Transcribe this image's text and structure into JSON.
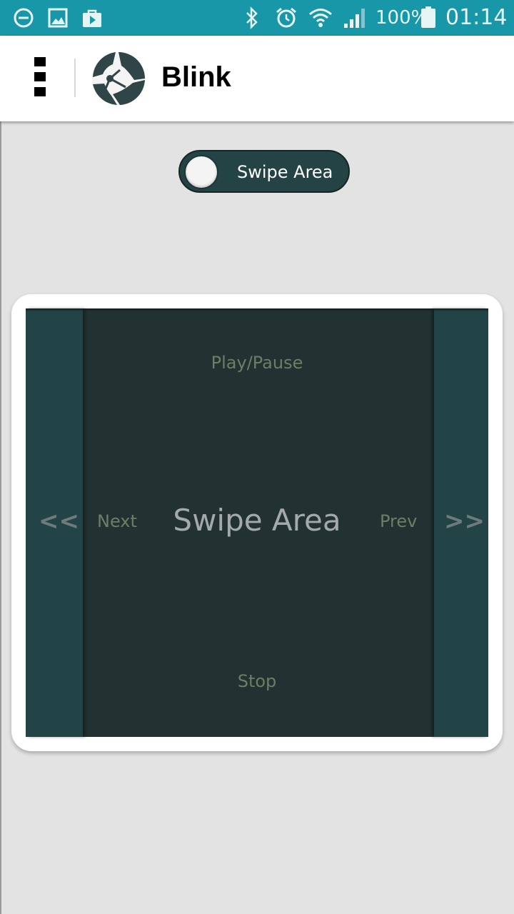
{
  "status_bar": {
    "battery_percent": "100%",
    "time": "01:14",
    "icons": [
      "do-not-disturb-icon",
      "image-icon",
      "play-store-icon",
      "bluetooth-icon",
      "alarm-icon",
      "wifi-icon",
      "signal-icon",
      "battery-icon"
    ],
    "color": "#1797a8"
  },
  "app_bar": {
    "title": "Blink",
    "menu_icon": "menu-icon",
    "logo_icon": "blink-logo-icon"
  },
  "toggle": {
    "label": "Swipe Area",
    "state": "off"
  },
  "swipe_area": {
    "title": "Swipe Area",
    "top_label": "Play/Pause",
    "bottom_label": "Stop",
    "left_label": "Next",
    "right_label": "Prev",
    "left_arrow": "<<",
    "right_arrow": ">>"
  },
  "colors": {
    "accent": "#1797a8",
    "panel": "#223131",
    "side_panel": "#234447",
    "label": "#6b7f66"
  }
}
